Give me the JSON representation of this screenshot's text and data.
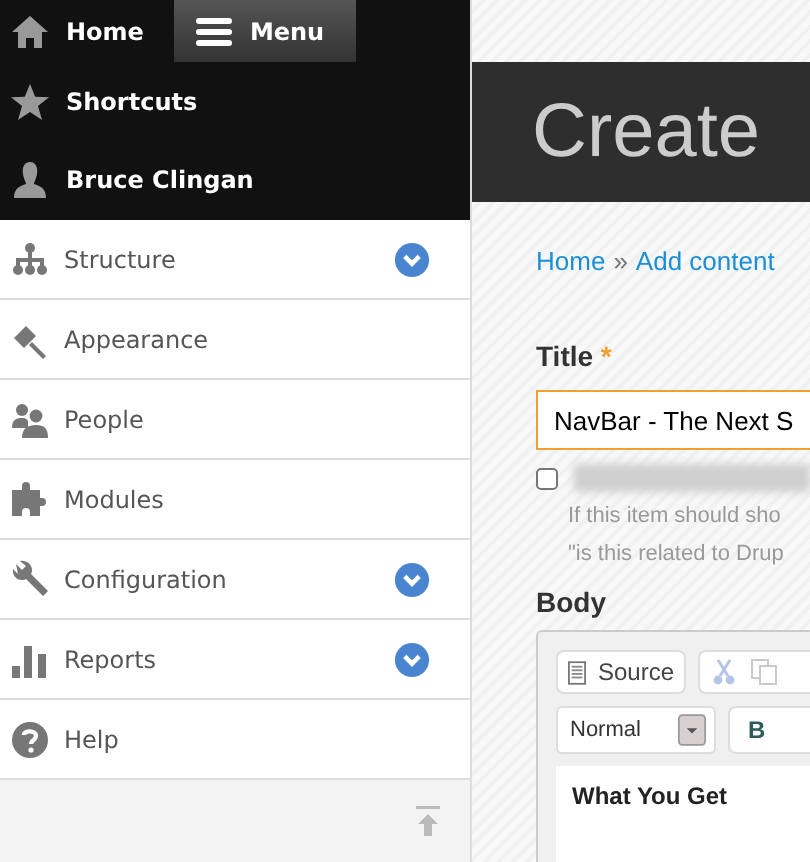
{
  "toolbar": {
    "items": [
      {
        "label": "Home",
        "selected": false
      },
      {
        "label": "Menu",
        "selected": true
      },
      {
        "label": "Shortcuts",
        "selected": false
      },
      {
        "label": "Bruce Clingan",
        "selected": false
      }
    ]
  },
  "sidebar": {
    "items": [
      {
        "label": "Structure",
        "expandable": true
      },
      {
        "label": "Appearance",
        "expandable": false
      },
      {
        "label": "People",
        "expandable": false
      },
      {
        "label": "Modules",
        "expandable": false
      },
      {
        "label": "Configuration",
        "expandable": true
      },
      {
        "label": "Reports",
        "expandable": true
      },
      {
        "label": "Help",
        "expandable": false
      }
    ]
  },
  "page": {
    "title": "Create",
    "breadcrumb": [
      {
        "label": "Home"
      },
      {
        "label": "Add content"
      }
    ],
    "breadcrumb_separator": "»",
    "title_field": {
      "label": "Title",
      "required_mark": "*",
      "value": "NavBar - The Next S"
    },
    "checkbox": {
      "checked": false
    },
    "hint_lines": [
      "If this item should sho",
      "\"is this related to Drup"
    ],
    "body_label": "Body",
    "editor": {
      "source_button": "Source",
      "cut_disabled": true,
      "format": "Normal",
      "bold_button": "B",
      "content_heading": "What You Get"
    }
  }
}
